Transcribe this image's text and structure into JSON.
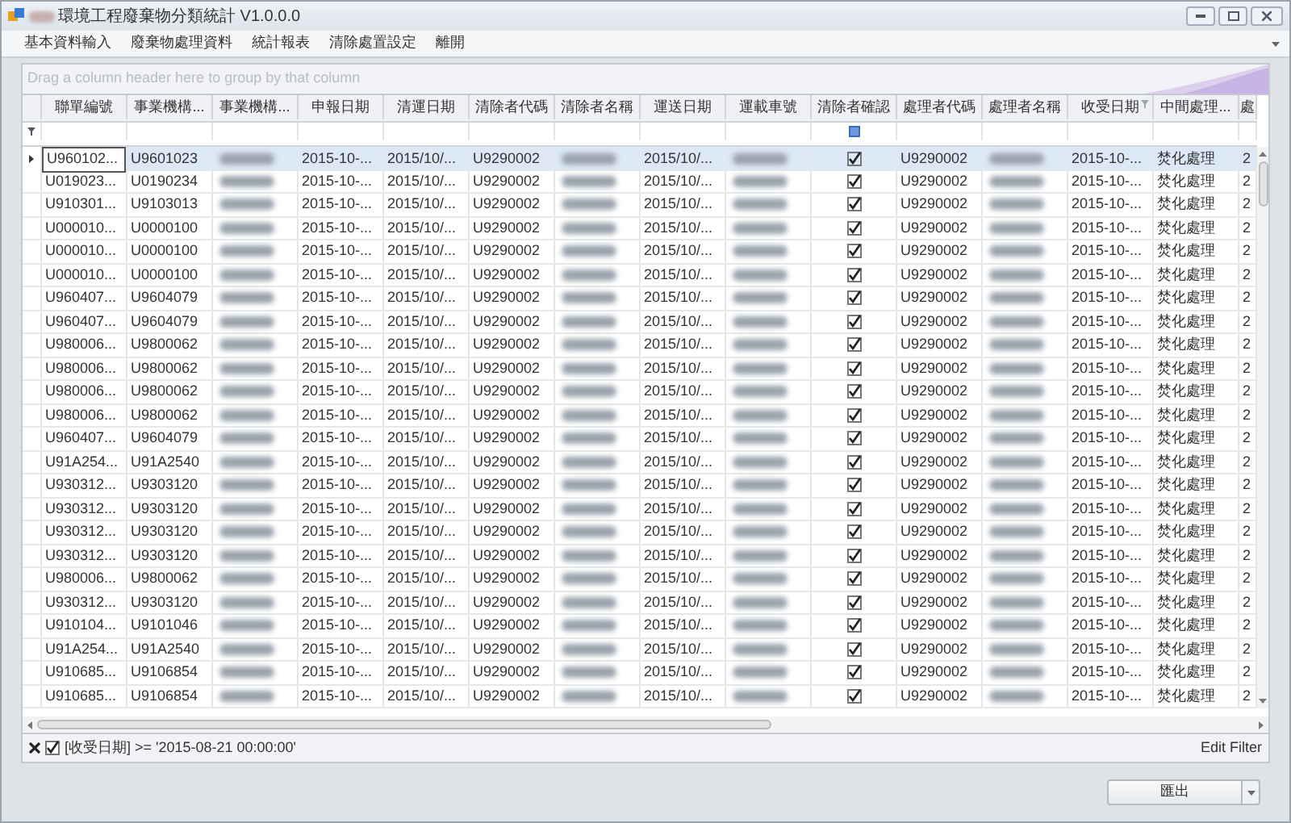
{
  "window": {
    "title": "環境工程廢棄物分類統計 V1.0.0.0"
  },
  "menu": [
    "基本資料輸入",
    "廢棄物處理資料",
    "統計報表",
    "清除處置設定",
    "離開"
  ],
  "group_panel": {
    "hint": "Drag a column header here to group by that column"
  },
  "columns": [
    {
      "label": "聯單編號",
      "kind": "text"
    },
    {
      "label": "事業機構...",
      "kind": "text"
    },
    {
      "label": "事業機構...",
      "kind": "redacted"
    },
    {
      "label": "申報日期",
      "kind": "text"
    },
    {
      "label": "清運日期",
      "kind": "text"
    },
    {
      "label": "清除者代碼",
      "kind": "text"
    },
    {
      "label": "清除者名稱",
      "kind": "redacted"
    },
    {
      "label": "運送日期",
      "kind": "text"
    },
    {
      "label": "運載車號",
      "kind": "redacted"
    },
    {
      "label": "清除者確認",
      "kind": "check",
      "filter_checked": true
    },
    {
      "label": "處理者代碼",
      "kind": "text"
    },
    {
      "label": "處理者名稱",
      "kind": "redacted"
    },
    {
      "label": "收受日期",
      "kind": "text",
      "filtered": true
    },
    {
      "label": "中間處理...",
      "kind": "text"
    },
    {
      "label": "處",
      "kind": "text"
    }
  ],
  "rows": [
    {
      "selected": true,
      "confirmed": true,
      "cells": [
        "U960102...",
        "U9601023",
        "2015-10-...",
        "2015/10/...",
        "U9290002",
        "2015/10/...",
        "U9290002",
        "2015-10-...",
        "焚化處理",
        "2"
      ]
    },
    {
      "selected": false,
      "confirmed": true,
      "cells": [
        "U019023...",
        "U0190234",
        "2015-10-...",
        "2015/10/...",
        "U9290002",
        "2015/10/...",
        "U9290002",
        "2015-10-...",
        "焚化處理",
        "2"
      ]
    },
    {
      "selected": false,
      "confirmed": true,
      "cells": [
        "U910301...",
        "U9103013",
        "2015-10-...",
        "2015/10/...",
        "U9290002",
        "2015/10/...",
        "U9290002",
        "2015-10-...",
        "焚化處理",
        "2"
      ]
    },
    {
      "selected": false,
      "confirmed": true,
      "cells": [
        "U000010...",
        "U0000100",
        "2015-10-...",
        "2015/10/...",
        "U9290002",
        "2015/10/...",
        "U9290002",
        "2015-10-...",
        "焚化處理",
        "2"
      ]
    },
    {
      "selected": false,
      "confirmed": true,
      "cells": [
        "U000010...",
        "U0000100",
        "2015-10-...",
        "2015/10/...",
        "U9290002",
        "2015/10/...",
        "U9290002",
        "2015-10-...",
        "焚化處理",
        "2"
      ]
    },
    {
      "selected": false,
      "confirmed": true,
      "cells": [
        "U000010...",
        "U0000100",
        "2015-10-...",
        "2015/10/...",
        "U9290002",
        "2015/10/...",
        "U9290002",
        "2015-10-...",
        "焚化處理",
        "2"
      ]
    },
    {
      "selected": false,
      "confirmed": true,
      "cells": [
        "U960407...",
        "U9604079",
        "2015-10-...",
        "2015/10/...",
        "U9290002",
        "2015/10/...",
        "U9290002",
        "2015-10-...",
        "焚化處理",
        "2"
      ]
    },
    {
      "selected": false,
      "confirmed": true,
      "cells": [
        "U960407...",
        "U9604079",
        "2015-10-...",
        "2015/10/...",
        "U9290002",
        "2015/10/...",
        "U9290002",
        "2015-10-...",
        "焚化處理",
        "2"
      ]
    },
    {
      "selected": false,
      "confirmed": true,
      "cells": [
        "U980006...",
        "U9800062",
        "2015-10-...",
        "2015/10/...",
        "U9290002",
        "2015/10/...",
        "U9290002",
        "2015-10-...",
        "焚化處理",
        "2"
      ]
    },
    {
      "selected": false,
      "confirmed": true,
      "cells": [
        "U980006...",
        "U9800062",
        "2015-10-...",
        "2015/10/...",
        "U9290002",
        "2015/10/...",
        "U9290002",
        "2015-10-...",
        "焚化處理",
        "2"
      ]
    },
    {
      "selected": false,
      "confirmed": true,
      "cells": [
        "U980006...",
        "U9800062",
        "2015-10-...",
        "2015/10/...",
        "U9290002",
        "2015/10/...",
        "U9290002",
        "2015-10-...",
        "焚化處理",
        "2"
      ]
    },
    {
      "selected": false,
      "confirmed": true,
      "cells": [
        "U980006...",
        "U9800062",
        "2015-10-...",
        "2015/10/...",
        "U9290002",
        "2015/10/...",
        "U9290002",
        "2015-10-...",
        "焚化處理",
        "2"
      ]
    },
    {
      "selected": false,
      "confirmed": true,
      "cells": [
        "U960407...",
        "U9604079",
        "2015-10-...",
        "2015/10/...",
        "U9290002",
        "2015/10/...",
        "U9290002",
        "2015-10-...",
        "焚化處理",
        "2"
      ]
    },
    {
      "selected": false,
      "confirmed": true,
      "cells": [
        "U91A254...",
        "U91A2540",
        "2015-10-...",
        "2015/10/...",
        "U9290002",
        "2015/10/...",
        "U9290002",
        "2015-10-...",
        "焚化處理",
        "2"
      ]
    },
    {
      "selected": false,
      "confirmed": true,
      "cells": [
        "U930312...",
        "U9303120",
        "2015-10-...",
        "2015/10/...",
        "U9290002",
        "2015/10/...",
        "U9290002",
        "2015-10-...",
        "焚化處理",
        "2"
      ]
    },
    {
      "selected": false,
      "confirmed": true,
      "cells": [
        "U930312...",
        "U9303120",
        "2015-10-...",
        "2015/10/...",
        "U9290002",
        "2015/10/...",
        "U9290002",
        "2015-10-...",
        "焚化處理",
        "2"
      ]
    },
    {
      "selected": false,
      "confirmed": true,
      "cells": [
        "U930312...",
        "U9303120",
        "2015-10-...",
        "2015/10/...",
        "U9290002",
        "2015/10/...",
        "U9290002",
        "2015-10-...",
        "焚化處理",
        "2"
      ]
    },
    {
      "selected": false,
      "confirmed": true,
      "cells": [
        "U930312...",
        "U9303120",
        "2015-10-...",
        "2015/10/...",
        "U9290002",
        "2015/10/...",
        "U9290002",
        "2015-10-...",
        "焚化處理",
        "2"
      ]
    },
    {
      "selected": false,
      "confirmed": true,
      "cells": [
        "U980006...",
        "U9800062",
        "2015-10-...",
        "2015/10/...",
        "U9290002",
        "2015/10/...",
        "U9290002",
        "2015-10-...",
        "焚化處理",
        "2"
      ]
    },
    {
      "selected": false,
      "confirmed": true,
      "cells": [
        "U930312...",
        "U9303120",
        "2015-10-...",
        "2015/10/...",
        "U9290002",
        "2015/10/...",
        "U9290002",
        "2015-10-...",
        "焚化處理",
        "2"
      ]
    },
    {
      "selected": false,
      "confirmed": true,
      "cells": [
        "U910104...",
        "U9101046",
        "2015-10-...",
        "2015/10/...",
        "U9290002",
        "2015/10/...",
        "U9290002",
        "2015-10-...",
        "焚化處理",
        "2"
      ]
    },
    {
      "selected": false,
      "confirmed": true,
      "cells": [
        "U91A254...",
        "U91A2540",
        "2015-10-...",
        "2015/10/...",
        "U9290002",
        "2015/10/...",
        "U9290002",
        "2015-10-...",
        "焚化處理",
        "2"
      ]
    },
    {
      "selected": false,
      "confirmed": true,
      "cells": [
        "U910685...",
        "U9106854",
        "2015-10-...",
        "2015/10/...",
        "U9290002",
        "2015/10/...",
        "U9290002",
        "2015-10-...",
        "焚化處理",
        "2"
      ]
    },
    {
      "selected": false,
      "confirmed": true,
      "cells": [
        "U910685...",
        "U9106854",
        "2015-10-...",
        "2015/10/...",
        "U9290002",
        "2015/10/...",
        "U9290002",
        "2015-10-...",
        "焚化處理",
        "2"
      ]
    }
  ],
  "filter_bar": {
    "enabled": true,
    "expression": "[收受日期] >= '2015-08-21 00:00:00'",
    "edit_link": "Edit Filter"
  },
  "export_button": {
    "label": "匯出"
  }
}
